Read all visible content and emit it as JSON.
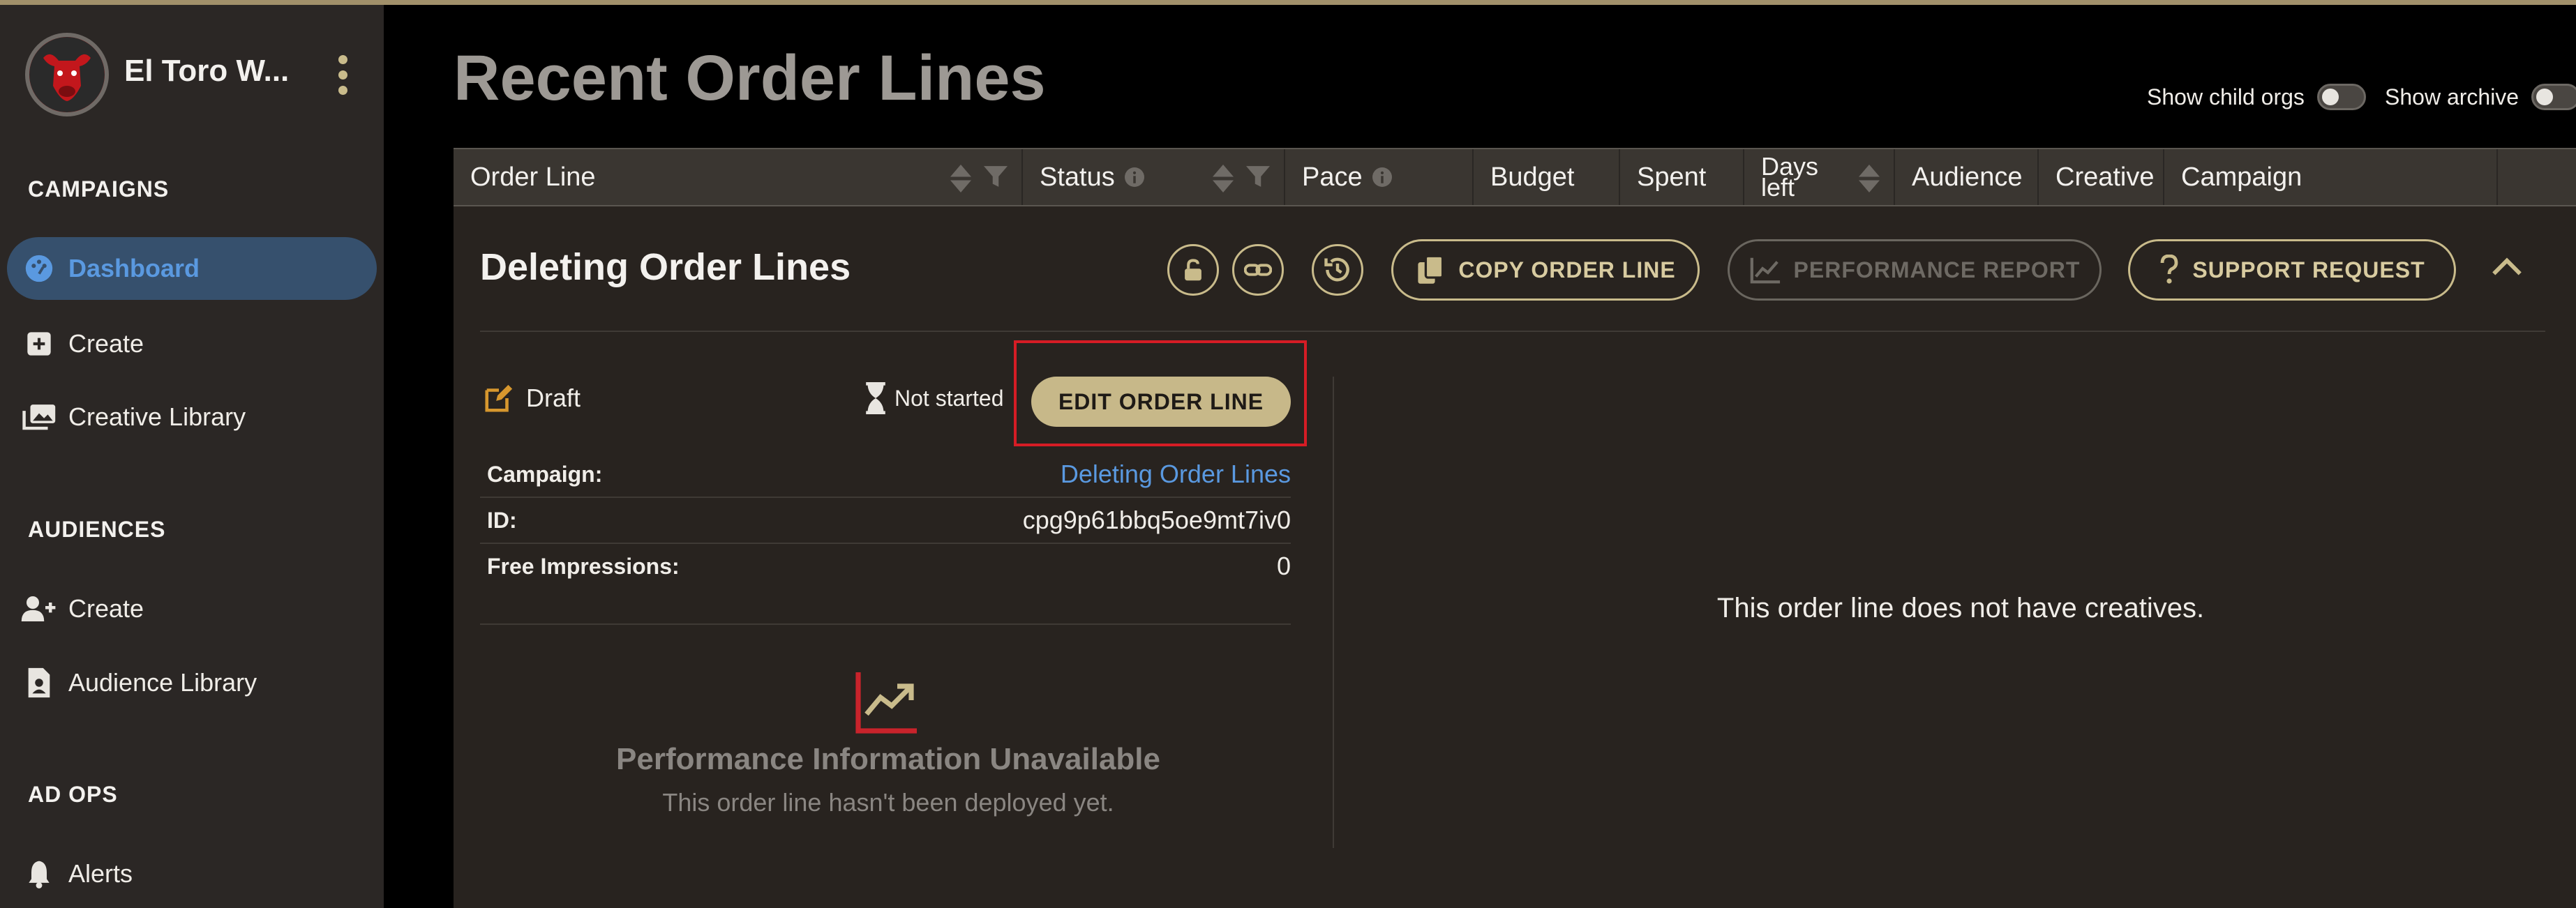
{
  "org": {
    "name": "El Toro W..."
  },
  "sidebar": {
    "sections": [
      {
        "title": "CAMPAIGNS",
        "items": [
          {
            "label": "Dashboard",
            "icon": "dashboard-icon",
            "active": true
          },
          {
            "label": "Create",
            "icon": "plus-square-icon"
          },
          {
            "label": "Creative Library",
            "icon": "images-icon"
          }
        ]
      },
      {
        "title": "AUDIENCES",
        "items": [
          {
            "label": "Create",
            "icon": "user-plus-icon"
          },
          {
            "label": "Audience Library",
            "icon": "file-user-icon"
          }
        ]
      },
      {
        "title": "AD OPS",
        "items": [
          {
            "label": "Alerts",
            "icon": "bell-icon"
          }
        ]
      }
    ]
  },
  "page": {
    "title": "Recent Order Lines"
  },
  "toggles": {
    "show_child_orgs": "Show child orgs",
    "show_archive": "Show archive"
  },
  "table": {
    "columns": [
      "Order Line",
      "Status",
      "Pace",
      "Budget",
      "Spent",
      "Days left",
      "Audience",
      "Creative",
      "Campaign"
    ]
  },
  "order_line": {
    "title": "Deleting Order Lines",
    "actions": {
      "copy": "COPY ORDER LINE",
      "performance": "PERFORMANCE REPORT",
      "support": "SUPPORT REQUEST"
    },
    "status": "Draft",
    "deploy_status": "Not started",
    "edit_label": "EDIT ORDER LINE",
    "details": [
      {
        "label": "Campaign:",
        "value": "Deleting Order Lines"
      },
      {
        "label": "ID:",
        "value": "cpg9p61bbq5oe9mt7iv0"
      },
      {
        "label": "Free Impressions:",
        "value": "0"
      }
    ],
    "performance": {
      "title": "Performance Information Unavailable",
      "subtitle": "This order line hasn't been deployed yet."
    },
    "creatives_message": "This order line does not have creatives."
  },
  "colors": {
    "accent": "#c9bb8b",
    "link": "#5a99e0",
    "highlight": "#d61c25"
  }
}
